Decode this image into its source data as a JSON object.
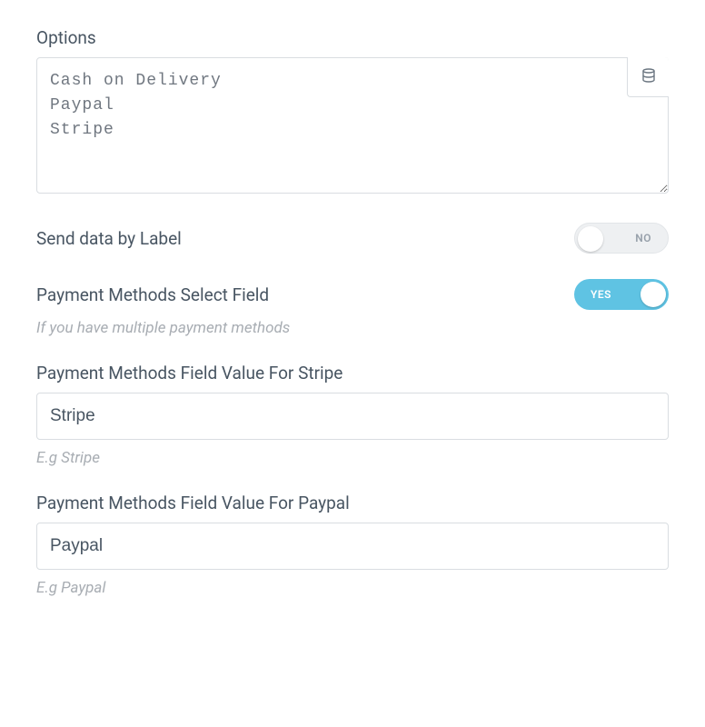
{
  "options": {
    "label": "Options",
    "value": "Cash on Delivery\nPaypal\nStripe"
  },
  "send_by_label": {
    "label": "Send data by Label",
    "value": false,
    "text_off": "NO",
    "text_on": "YES"
  },
  "pm_select": {
    "label": "Payment Methods Select Field",
    "helper": "If you have multiple payment methods",
    "value": true,
    "text_off": "NO",
    "text_on": "YES"
  },
  "stripe_value": {
    "label": "Payment Methods Field Value For Stripe",
    "value": "Stripe",
    "helper": "E.g Stripe"
  },
  "paypal_value": {
    "label": "Payment Methods Field Value For Paypal",
    "value": "Paypal",
    "helper": "E.g Paypal"
  }
}
